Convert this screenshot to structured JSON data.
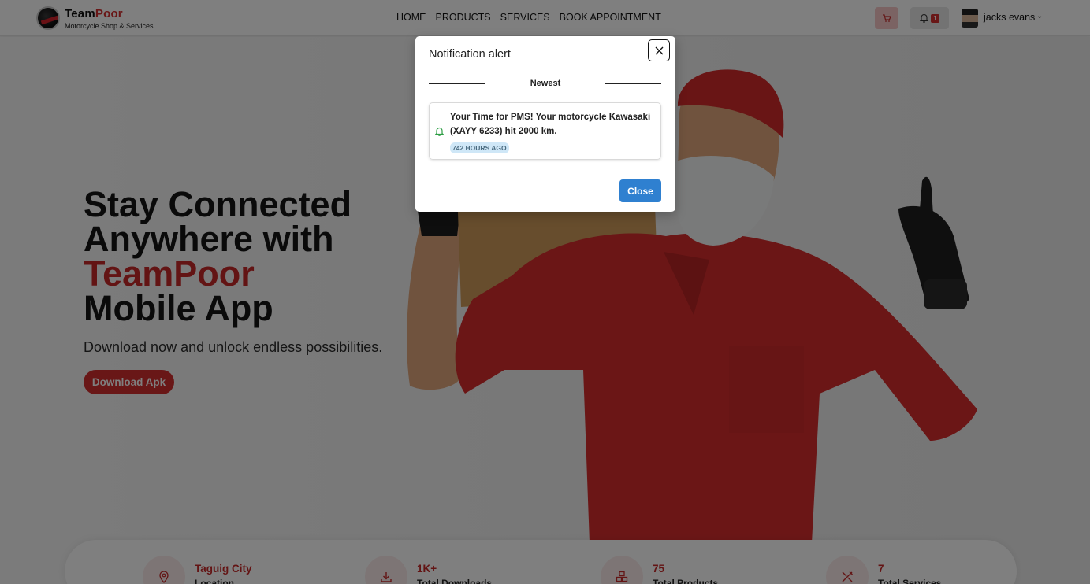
{
  "header": {
    "brand_main": "Team",
    "brand_accent": "Poor",
    "brand_sub": "Motorcycle Shop & Services",
    "nav": [
      "HOME",
      "PRODUCTS",
      "SERVICES",
      "BOOK APPOINTMENT"
    ],
    "notification_count": "1",
    "user_name": "jacks evans"
  },
  "hero": {
    "title_line1": "Stay Connected",
    "title_line2": "Anywhere with",
    "title_accent": "TeamPoor",
    "title_line4": "Mobile App",
    "subtitle": "Download now and unlock endless possibilities.",
    "download_label": "Download Apk"
  },
  "stats": [
    {
      "icon": "location-pin-icon",
      "value": "Taguig City",
      "label": "Location"
    },
    {
      "icon": "download-icon",
      "value": "1K+",
      "label": "Total Downloads"
    },
    {
      "icon": "products-icon",
      "value": "75",
      "label": "Total Products"
    },
    {
      "icon": "tools-icon",
      "value": "7",
      "label": "Total Services"
    }
  ],
  "modal": {
    "title": "Notification alert",
    "section_label": "Newest",
    "notification_text": "Your Time for PMS! Your motorcycle Kawasaki (XAYY 6233) hit 2000 km.",
    "notification_time": "742 HOURS AGO",
    "close_label": "Close"
  },
  "colors": {
    "brand_red": "#d32f2f",
    "primary_blue": "#2f80d0",
    "bell_green": "#2e9e45"
  }
}
